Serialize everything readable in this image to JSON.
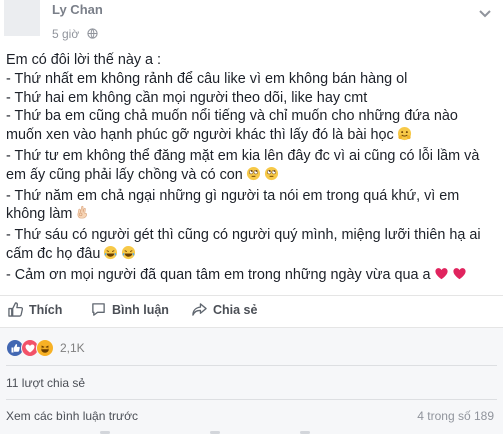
{
  "post": {
    "author": "Ly Chan",
    "time": "5 giờ",
    "lines": [
      "Em có đôi lời thế này a :",
      "- Thứ nhất em không rảnh để câu like vì em không bán hàng ol",
      "- Thứ hai em không cần mọi người theo dõi, like hay cmt",
      "- Thứ ba em cũng chả muốn nổi tiếng và chỉ muốn cho những đứa nào",
      "muốn xen vào hạnh phúc gỡ người khác thì lấy đó là bài học",
      "- Thứ tư em không thể đăng mặt em kia lên đây đc vì ai cũng có lỗi lầm và",
      "em ấy cũng phải lấy chồng và có con",
      "- Thứ năm em chả ngại những gì người ta nói em trong quá khứ, vì em",
      "không làm",
      "- Thứ sáu có người gét thì cũng có người quý mình, miệng lưỡi thiên hạ ai",
      "cấm đc họ đâu",
      "- Cảm ơn mọi người đã quan tâm em trong những ngày vừa qua a"
    ],
    "line_emojis": {
      "4": [
        "hugging-emoji"
      ],
      "6": [
        "rolling-eyes-emoji",
        "rolling-eyes-emoji"
      ],
      "8": [
        "ok-hand-emoji"
      ],
      "10": [
        "tears-of-joy-emoji",
        "tears-of-joy-emoji"
      ],
      "11": [
        "heart-emoji",
        "heart-emoji"
      ]
    }
  },
  "actions": {
    "like_label": "Thích",
    "comment_label": "Bình luận",
    "share_label": "Chia sẻ"
  },
  "feedback": {
    "reactions": [
      "like",
      "love",
      "haha"
    ],
    "reaction_count": "2,1K",
    "shares": "11 lượt chia sẻ",
    "view_previous": "Xem các bình luận trước",
    "comment_count": "4 trong số 189"
  },
  "colors": {
    "like_blue": "#4267b2",
    "love_red": "#f25268",
    "haha_yellow": "#f7b125",
    "heart_red": "#e0245e",
    "emoji_yellow": "#f7c948"
  }
}
